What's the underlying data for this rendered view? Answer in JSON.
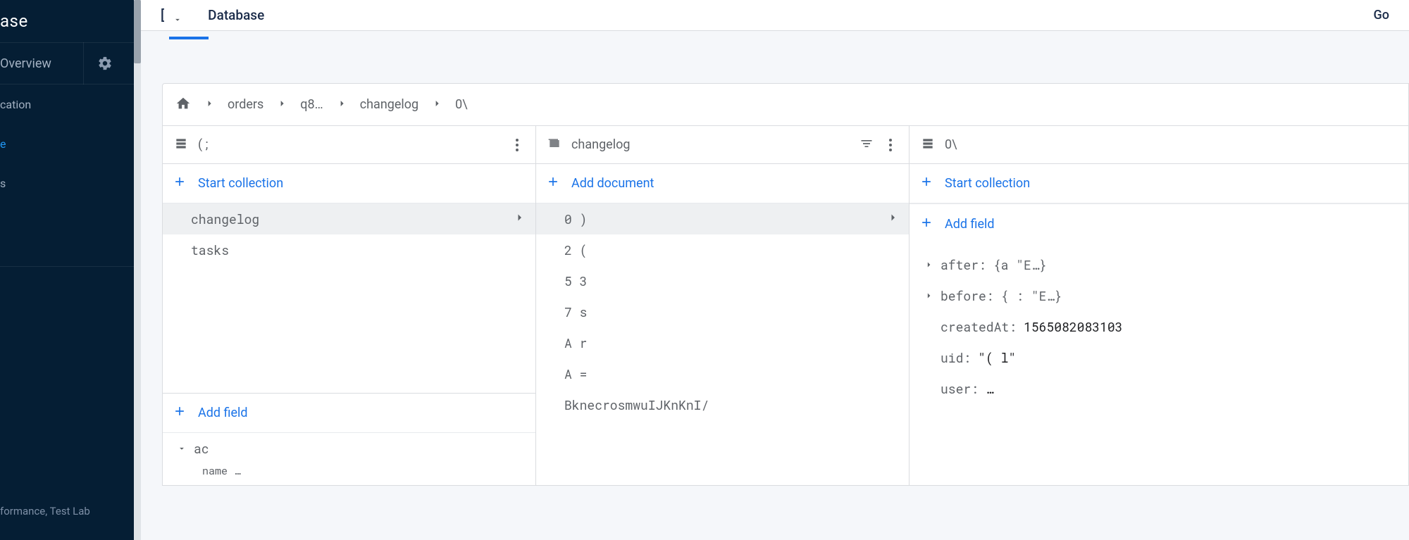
{
  "brand": {
    "suffix": "ase"
  },
  "sidebar": {
    "overview": "Overview",
    "items": [
      {
        "label": "cation",
        "active": false,
        "name": "sidebar-item-cation"
      },
      {
        "label": "e",
        "active": true,
        "name": "sidebar-item-e"
      },
      {
        "label": "s",
        "active": false,
        "name": "sidebar-item-s"
      }
    ],
    "footer": "formance, Test Lab"
  },
  "header": {
    "project_prefix": "[",
    "database": "Database",
    "goto": "Go"
  },
  "breadcrumb": {
    "segments": [
      "orders",
      "q8…",
      "changelog",
      "0\\"
    ]
  },
  "col1": {
    "header_title": "(                            ;",
    "start_collection": "Start collection",
    "items": [
      {
        "label": "changelog",
        "selected": true
      },
      {
        "label": "tasks",
        "selected": false
      }
    ],
    "add_field": "Add field",
    "expanded_field": "ac",
    "expanded_sub": "name  …"
  },
  "col2": {
    "header_title": "changelog",
    "add_document": "Add document",
    "items": [
      {
        "label": "0                       )",
        "selected": true
      },
      {
        "label": "2                       (",
        "selected": false
      },
      {
        "label": "5                       3",
        "selected": false
      },
      {
        "label": "7                       s",
        "selected": false
      },
      {
        "label": "A                       r",
        "selected": false
      },
      {
        "label": "A                       =",
        "selected": false
      },
      {
        "label": "BknecrosmwuIJKnKnI/",
        "selected": false
      }
    ]
  },
  "col3": {
    "header_title": "0\\",
    "start_collection": "Start collection",
    "add_field": "Add field",
    "fields": [
      {
        "kind": "obj",
        "key": "after:",
        "val": "{a                    \"E…}"
      },
      {
        "kind": "obj",
        "key": "before:",
        "val": "{                   : \"E…}"
      },
      {
        "kind": "plain",
        "key": "createdAt:",
        "val": "1565082083103"
      },
      {
        "kind": "plain",
        "key": "uid:",
        "val": "\"(                          l\""
      },
      {
        "kind": "plain",
        "key": "user:",
        "val": "…"
      }
    ]
  }
}
